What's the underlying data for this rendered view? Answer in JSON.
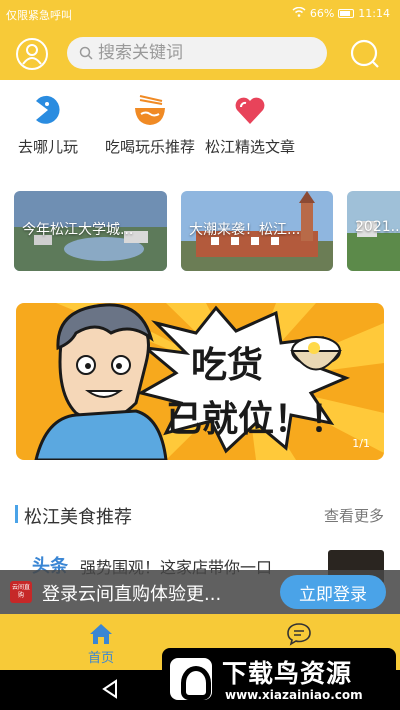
{
  "status_bar": {
    "left_text": "仅限紧急呼叫",
    "battery": "66%",
    "time": "11:14"
  },
  "header": {
    "search_placeholder": "搜索关键词",
    "avatar_icon": "user-avatar-icon",
    "search_icon": "search-icon"
  },
  "categories": [
    {
      "label": "去哪儿玩",
      "icon": "pacman-icon",
      "color": "#2a8ce0"
    },
    {
      "label": "吃喝玩乐推荐",
      "icon": "noodle-bowl-icon",
      "color": "#f08a24"
    },
    {
      "label": "松江精选文章",
      "icon": "heart-icon",
      "color": "#e8435a"
    }
  ],
  "articles": [
    {
      "title": "今年松江大学城..."
    },
    {
      "title": "大潮来袭！松江..."
    },
    {
      "title": "2021..."
    }
  ],
  "banner": {
    "line1": "吃货",
    "line2": "已就位！！",
    "counter": "1/1"
  },
  "section": {
    "title": "松江美食推荐",
    "more": "查看更多"
  },
  "news": {
    "tag": "头条",
    "text": "强势围观！这家店带你一口"
  },
  "login_prompt": {
    "logo_text": "云间直购",
    "text": "登录云间直购体验更...",
    "button": "立即登录"
  },
  "tabbar": {
    "home_label": "首页"
  },
  "watermark": {
    "title": "下载鸟资源",
    "url": "www.xiazainiao.com"
  },
  "colors": {
    "brand_yellow": "#f7ca38",
    "accent_blue": "#4aa3e8"
  }
}
